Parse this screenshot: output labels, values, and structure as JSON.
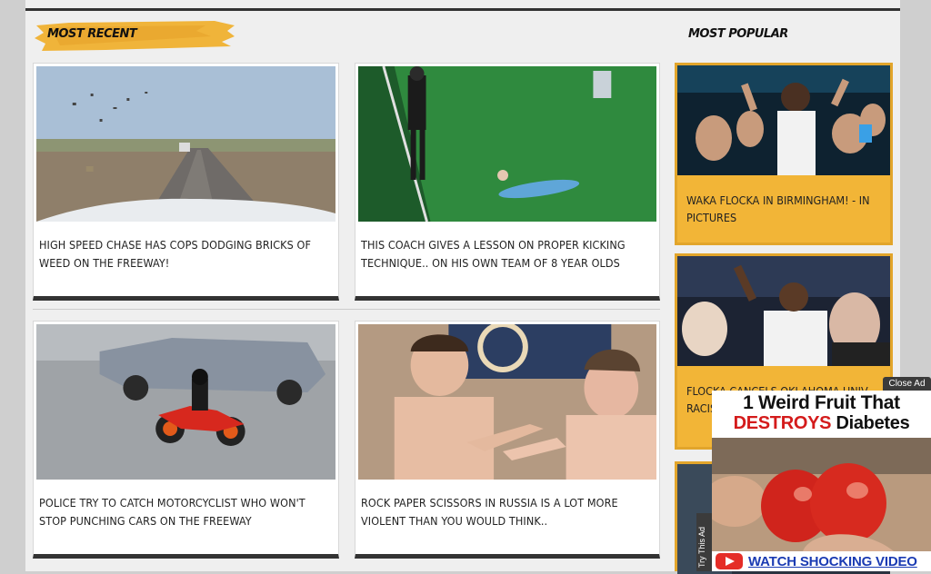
{
  "sections": {
    "most_recent": "MOST RECENT",
    "most_popular": "MOST POPULAR"
  },
  "recent": [
    {
      "caption": "HIGH SPEED CHASE HAS COPS DODGING BRICKS OF WEED ON THE FREEWAY!"
    },
    {
      "caption": "THIS COACH GIVES A LESSON ON PROPER KICKING TECHNIQUE.. ON HIS OWN TEAM OF 8 YEAR OLDS"
    },
    {
      "caption": "POLICE TRY TO CATCH MOTORCYCLIST WHO WON'T STOP PUNCHING CARS ON THE FREEWAY"
    },
    {
      "caption": "ROCK PAPER SCISSORS IN RUSSIA IS A LOT MORE VIOLENT THAN YOU WOULD THINK.."
    }
  ],
  "popular": [
    {
      "caption": "WAKA FLOCKA IN BIRMINGHAM! - IN PICTURES"
    },
    {
      "caption": "FLOCKA CANCELS OKLAHOMA UNIV... RACIS..."
    }
  ],
  "ad": {
    "close_label": "Close Ad",
    "side_label": "Try This Ad",
    "line1": "1 Weird Fruit That",
    "line2_red": "DESTROYS",
    "line2_rest": " Diabetes",
    "cta": "WATCH SHOCKING VIDEO"
  },
  "colors": {
    "brand_yellow": "#f2b537",
    "ad_red": "#d41b1b",
    "ad_link": "#1a3bb3"
  }
}
